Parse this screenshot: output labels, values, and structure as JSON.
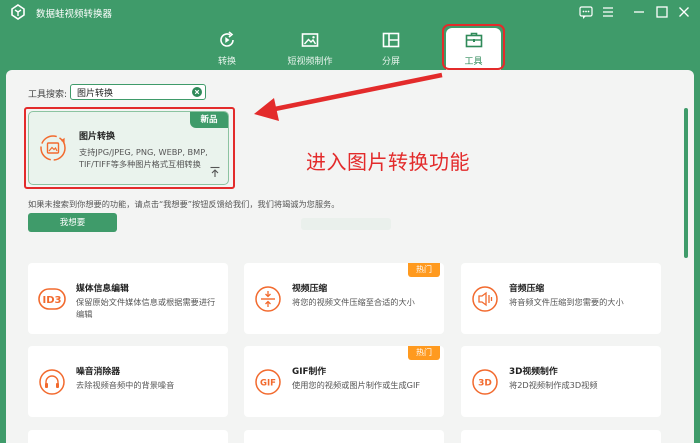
{
  "app": {
    "title": "数据蛙视频转换器"
  },
  "nav": {
    "tabs": [
      {
        "label": "转换",
        "icon": "play-refresh-icon"
      },
      {
        "label": "短视频制作",
        "icon": "image-frame-icon"
      },
      {
        "label": "分屏",
        "icon": "split-screen-icon"
      },
      {
        "label": "工具",
        "icon": "toolbox-icon",
        "active": true
      }
    ]
  },
  "search": {
    "label": "工具搜索:",
    "value": "图片转换"
  },
  "result": {
    "badge": "新品",
    "title": "图片转换",
    "description": "支持JPG/JPEG, PNG, WEBP, BMP, TIF/TIFF等多种图片格式互相转换"
  },
  "annotation": {
    "text": "进入图片转换功能"
  },
  "notice": {
    "text": "如果未搜索到你想要的功能，请点击“我想要”按钮反馈给我们，我们将竭诚为您服务。"
  },
  "want_button": {
    "label": "我想要"
  },
  "tools": [
    {
      "title": "媒体信息编辑",
      "description": "保留原始文件媒体信息或根据需要进行编辑",
      "icon": "id3-icon",
      "icon_text": "ID3",
      "hot": ""
    },
    {
      "title": "视频压缩",
      "description": "将您的视频文件压缩至合适的大小",
      "icon": "compress-icon",
      "hot": "热门"
    },
    {
      "title": "音频压缩",
      "description": "将音频文件压缩到您需要的大小",
      "icon": "audio-compress-icon",
      "hot": ""
    },
    {
      "title": "噪音消除器",
      "description": "去除视频音频中的背景噪音",
      "icon": "headphones-icon",
      "hot": ""
    },
    {
      "title": "GIF制作",
      "description": "使用您的视频或图片制作或生成GIF",
      "icon": "gif-icon",
      "icon_text": "GIF",
      "hot": "热门"
    },
    {
      "title": "3D视频制作",
      "description": "将2D视频制作成3D视频",
      "icon": "3d-icon",
      "icon_text": "3D",
      "hot": ""
    }
  ],
  "colors": {
    "brand": "#3f9b6a",
    "highlight": "#e32b2b",
    "hot": "#ff9a1f",
    "icon_accent": "#f26a2e"
  }
}
